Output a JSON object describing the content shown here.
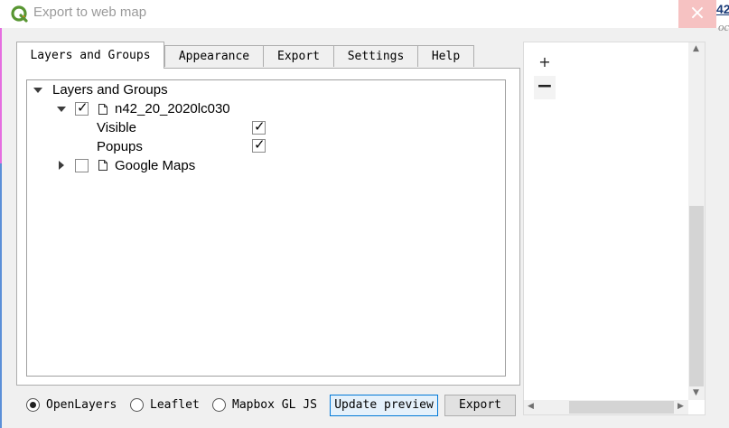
{
  "window": {
    "title": "Export to web map",
    "close_glyph": "×",
    "background_window_text": "42",
    "background_window_sub": "oc"
  },
  "tabs": [
    {
      "label": "Layers and Groups",
      "active": true
    },
    {
      "label": "Appearance",
      "active": false
    },
    {
      "label": "Export",
      "active": false
    },
    {
      "label": "Settings",
      "active": false
    },
    {
      "label": "Help",
      "active": false
    }
  ],
  "tree": {
    "root_label": "Layers and Groups",
    "layers": [
      {
        "name": "n42_20_2020lc030",
        "checked": true,
        "expanded": true,
        "options": [
          {
            "label": "Visible",
            "checked": true
          },
          {
            "label": "Popups",
            "checked": true
          }
        ]
      },
      {
        "name": "Google Maps",
        "checked": false,
        "expanded": false
      }
    ],
    "check_glyph": "✓"
  },
  "preview": {
    "zoom_in": "+",
    "zoom_out": "−"
  },
  "map_format": {
    "selected": "OpenLayers",
    "options": [
      "OpenLayers",
      "Leaflet",
      "Mapbox GL JS"
    ]
  },
  "buttons": {
    "update_preview": "Update preview",
    "export": "Export"
  },
  "icons": [
    "qgis-logo-icon",
    "close-icon",
    "file-icon",
    "expand-arrow-icon",
    "collapse-arrow-icon"
  ],
  "colors": {
    "qgis_green": "#589632",
    "qgis_yellow": "#ee7913",
    "close_red": "#f6c2c2",
    "focus_blue": "#0078d7"
  }
}
